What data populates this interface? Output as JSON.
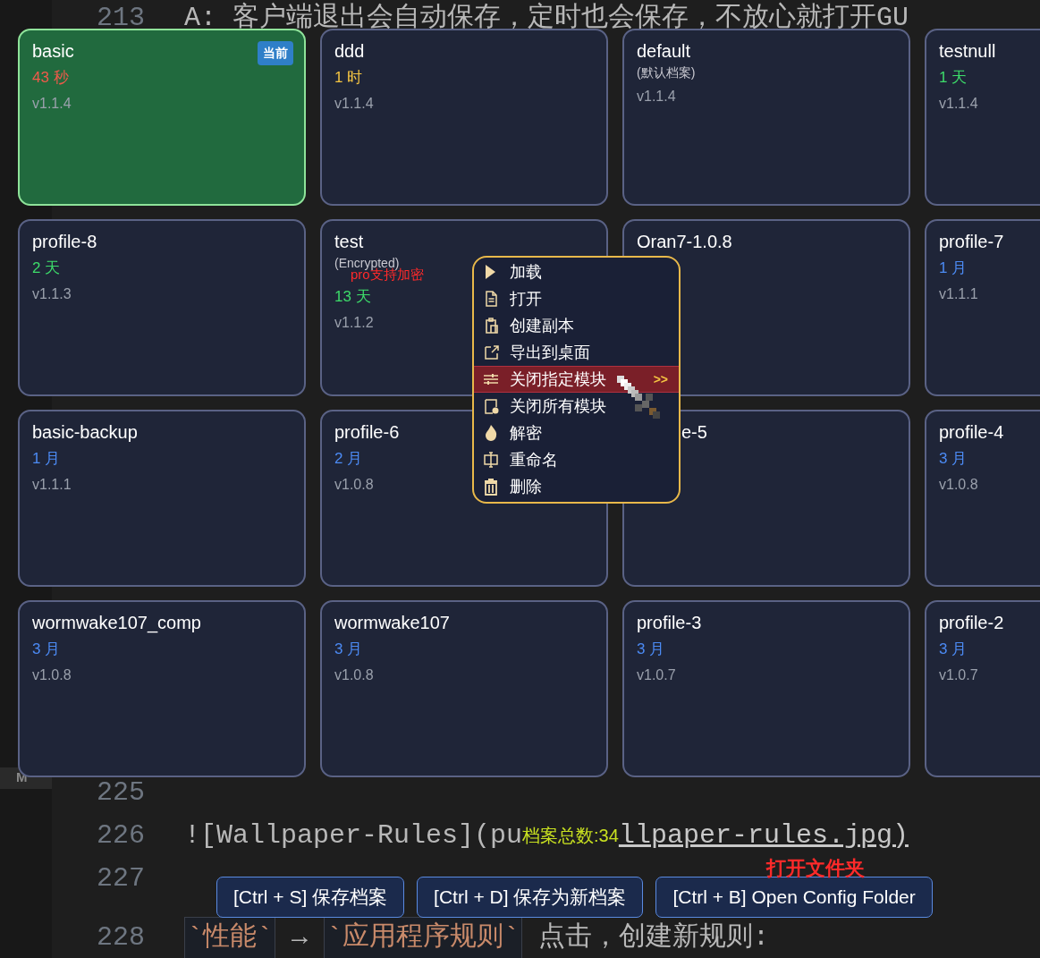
{
  "editor": {
    "gutter_marker": "M",
    "top_line": {
      "number": "213",
      "parts": [
        {
          "kind": "plain",
          "text": "A: 客户端退出会自动保存，定时也会保存，不放心就打开GU"
        }
      ]
    },
    "lines": [
      {
        "number": "225"
      },
      {
        "number": "226",
        "parts": [
          {
            "kind": "plain",
            "text": "![Wallpaper-Rules](pu"
          },
          {
            "kind": "count",
            "text": "档案总数:34"
          },
          {
            "kind": "url",
            "text": "llpaper-rules.jpg)"
          }
        ]
      },
      {
        "number": "227"
      },
      {
        "number": "228",
        "parts": [
          {
            "kind": "code",
            "text": "`性能`"
          },
          {
            "kind": "plain",
            "text": " → "
          },
          {
            "kind": "code",
            "text": "`应用程序规则`"
          },
          {
            "kind": "plain",
            "text": " 点击，创建新规则:"
          }
        ]
      }
    ]
  },
  "profiles": [
    {
      "name": "basic",
      "current": true,
      "badge": "当前",
      "age": "43 秒",
      "color": "#f05a4a",
      "version": "v1.1.4"
    },
    {
      "name": "ddd",
      "current": false,
      "age": "1 时",
      "color": "#f5c542",
      "version": "v1.1.4"
    },
    {
      "name": "default",
      "current": false,
      "note": "(默认档案)",
      "version": "v1.1.4"
    },
    {
      "name": "testnull",
      "current": false,
      "age": "1 天",
      "color": "#3ddc6a",
      "version": "v1.1.4"
    },
    {
      "name": "profile-8",
      "current": false,
      "age": "2 天",
      "color": "#3ddc6a",
      "version": "v1.1.3"
    },
    {
      "name": "test",
      "current": false,
      "note": "(Encrypted)",
      "annotation": "pro支持加密",
      "age": "13 天",
      "color": "#3ddc6a",
      "version": "v1.1.2"
    },
    {
      "name": "Oran7-1.0.8",
      "current": false
    },
    {
      "name": "profile-7",
      "current": false,
      "age": "1 月",
      "color": "#4c8bf5",
      "version": "v1.1.1"
    },
    {
      "name": "basic-backup",
      "current": false,
      "age": "1 月",
      "color": "#4c8bf5",
      "version": "v1.1.1"
    },
    {
      "name": "profile-6",
      "current": false,
      "age": "2 月",
      "color": "#4c8bf5",
      "version": "v1.0.8"
    },
    {
      "name": "e-5",
      "current": false,
      "partial": true
    },
    {
      "name": "profile-4",
      "current": false,
      "age": "3 月",
      "color": "#4c8bf5",
      "version": "v1.0.8"
    },
    {
      "name": "wormwake107_comp",
      "current": false,
      "age": "3 月",
      "color": "#4c8bf5",
      "version": "v1.0.8"
    },
    {
      "name": "wormwake107",
      "current": false,
      "age": "3 月",
      "color": "#4c8bf5",
      "version": "v1.0.8"
    },
    {
      "name": "profile-3",
      "current": false,
      "age": "3 月",
      "color": "#4c8bf5",
      "version": "v1.0.7"
    },
    {
      "name": "profile-2",
      "current": false,
      "age": "3 月",
      "color": "#4c8bf5",
      "version": "v1.0.7"
    }
  ],
  "context_menu": {
    "items": [
      {
        "label": "加载",
        "selected": false
      },
      {
        "label": "打开",
        "selected": false
      },
      {
        "label": "创建副本",
        "selected": false
      },
      {
        "label": "导出到桌面",
        "selected": false
      },
      {
        "label": "关闭指定模块",
        "selected": true,
        "submenu_marker": ">>"
      },
      {
        "label": "关闭所有模块",
        "selected": false
      },
      {
        "label": "解密",
        "selected": false
      },
      {
        "label": "重命名",
        "selected": false
      },
      {
        "label": "删除",
        "selected": false
      }
    ]
  },
  "buttons": [
    {
      "label": "[Ctrl + S] 保存档案"
    },
    {
      "label": "[Ctrl + D] 保存为新档案"
    },
    {
      "label": "[Ctrl + B] Open Config Folder",
      "annotation": "打开文件夹"
    }
  ]
}
